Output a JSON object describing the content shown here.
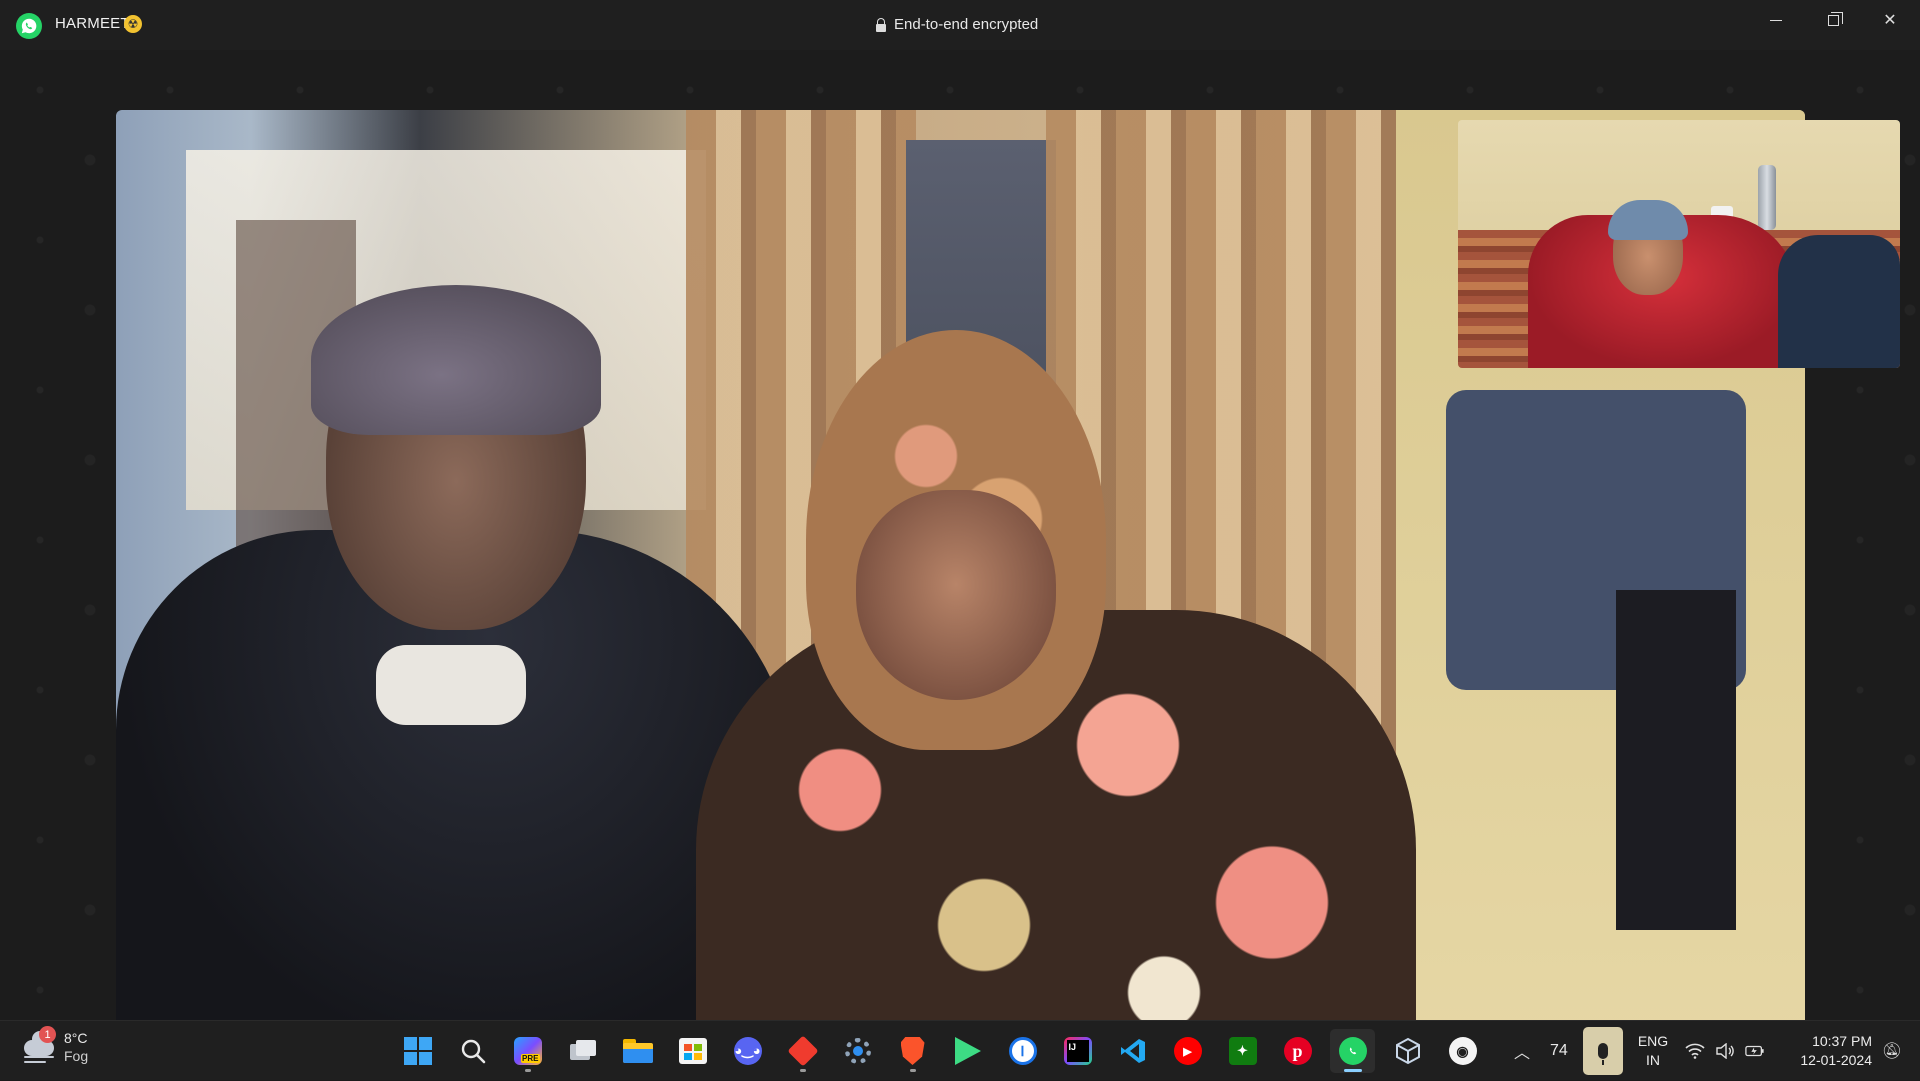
{
  "window": {
    "contact_name": "HARMEET",
    "contact_emoji": "☢",
    "encryption_text": "End-to-end encrypted"
  },
  "call": {
    "state": "video call"
  },
  "taskbar": {
    "weather": {
      "temperature": "8°C",
      "condition": "Fog",
      "badge": "1"
    },
    "apps": [
      {
        "name": "start",
        "icon": "windows-start-icon"
      },
      {
        "name": "search",
        "icon": "search-icon"
      },
      {
        "name": "copilot-pre",
        "icon": "copilot-icon",
        "label": "PRE"
      },
      {
        "name": "task-view",
        "icon": "task-view-icon"
      },
      {
        "name": "file-explorer",
        "icon": "folder-icon"
      },
      {
        "name": "microsoft-store",
        "icon": "store-icon"
      },
      {
        "name": "discord",
        "icon": "discord-icon"
      },
      {
        "name": "red-diamond-app",
        "icon": "diamond-icon"
      },
      {
        "name": "settings",
        "icon": "gear-icon"
      },
      {
        "name": "brave",
        "icon": "brave-icon"
      },
      {
        "name": "android-studio",
        "icon": "play-icon"
      },
      {
        "name": "1password",
        "icon": "key-icon"
      },
      {
        "name": "intellij",
        "icon": "ij-icon"
      },
      {
        "name": "vscode",
        "icon": "vscode-icon"
      },
      {
        "name": "youtube-music",
        "icon": "music-icon"
      },
      {
        "name": "xbox-game-bar",
        "icon": "gamebar-icon"
      },
      {
        "name": "pinterest",
        "icon": "pinterest-icon"
      },
      {
        "name": "whatsapp",
        "icon": "whatsapp-icon",
        "active": true
      },
      {
        "name": "virtualbox",
        "icon": "cube-icon"
      },
      {
        "name": "github-desktop",
        "icon": "github-icon"
      }
    ],
    "tray": {
      "counter": "74",
      "language": "ENG",
      "region": "IN",
      "time": "10:37 PM",
      "date": "12-01-2024"
    }
  },
  "colors": {
    "whatsapp_green": "#25d366",
    "taskbar_bg": "#1f1f1f",
    "accent": "#3ea7f5"
  }
}
